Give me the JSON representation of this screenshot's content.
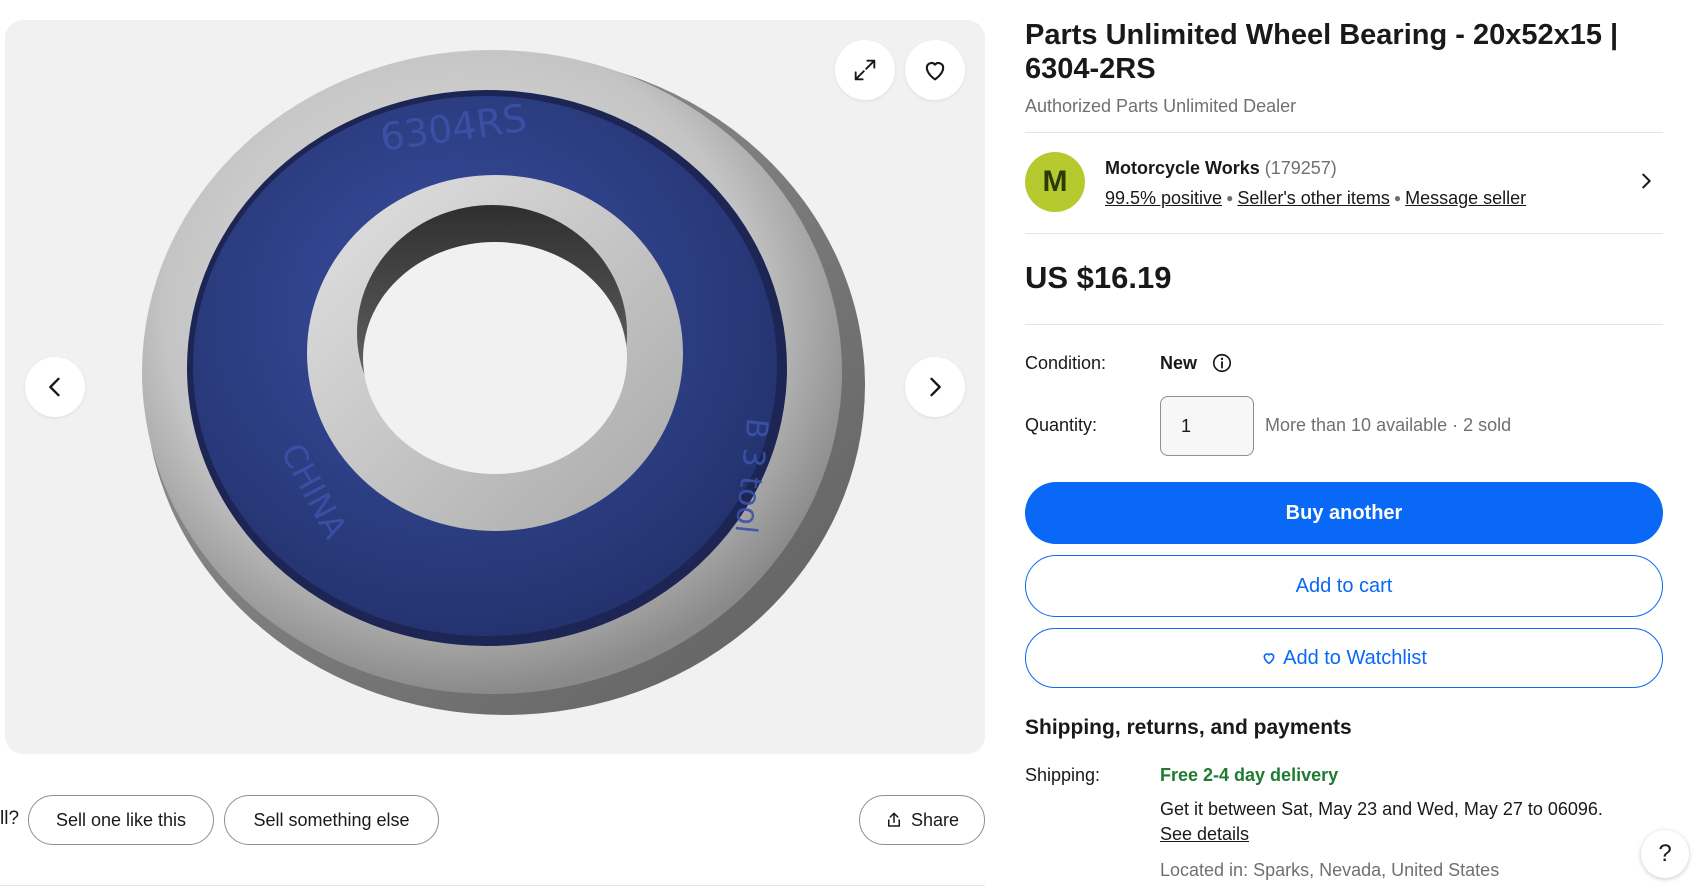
{
  "gallery": {
    "expand_icon": "expand-icon",
    "heart_icon": "heart-icon",
    "prev_icon": "chevron-left-icon",
    "next_icon": "chevron-right-icon",
    "image_alt": "Parts Unlimited Wheel Bearing 6304-2RS",
    "colors": {
      "background": "#f1f1f1",
      "seal": "#2e3f8c",
      "steel": "#c9c9c9"
    }
  },
  "actions": {
    "cut_text": "ll?",
    "sell_one": "Sell one like this",
    "sell_else": "Sell something else",
    "share": "Share"
  },
  "product": {
    "title": "Parts Unlimited Wheel Bearing - 20x52x15 | 6304-2RS",
    "subtitle": "Authorized Parts Unlimited Dealer"
  },
  "seller": {
    "avatar_letter": "M",
    "name": "Motorcycle Works",
    "feedback_count": "(179257)",
    "positive": "99.5% positive",
    "other_items": "Seller's other items",
    "message": "Message seller"
  },
  "price": "US $16.19",
  "condition": {
    "label": "Condition:",
    "value": "New"
  },
  "quantity": {
    "label": "Quantity:",
    "value": "1",
    "available": "More than 10 available · 2 sold"
  },
  "buttons": {
    "buy": "Buy another",
    "cart": "Add to cart",
    "watchlist": "Add to Watchlist"
  },
  "shipping": {
    "section_title": "Shipping, returns, and payments",
    "label": "Shipping:",
    "free": "Free 2-4 day delivery",
    "estimate": "Get it between Sat, May 23 and Wed, May 27 to 06096.",
    "details": "See details",
    "location": "Located in: Sparks, Nevada, United States"
  },
  "help": "?",
  "colors": {
    "accent": "#0968f6",
    "success": "#1e7b32",
    "avatar": "#b6ca2f"
  }
}
